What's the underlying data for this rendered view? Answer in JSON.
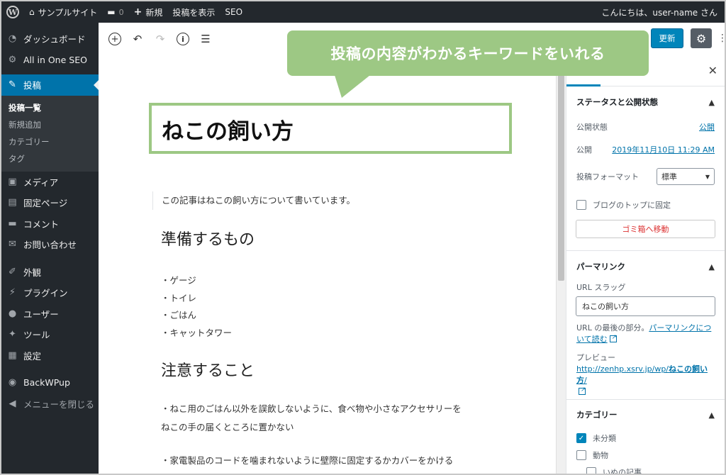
{
  "adminbar": {
    "site_name": "サンプルサイト",
    "comment_count": "0",
    "new_label": "新規",
    "view_post": "投稿を表示",
    "seo": "SEO",
    "greeting": "こんにちは、user-name さん"
  },
  "sidebar": {
    "items": [
      {
        "label": "ダッシュボード",
        "icon": "dashboard-icon"
      },
      {
        "label": "All in One SEO",
        "icon": "gear-icon"
      },
      {
        "label": "投稿",
        "icon": "pin-icon"
      },
      {
        "label": "メディア",
        "icon": "media-icon"
      },
      {
        "label": "固定ページ",
        "icon": "page-icon"
      },
      {
        "label": "コメント",
        "icon": "comment-icon"
      },
      {
        "label": "お問い合わせ",
        "icon": "mail-icon"
      },
      {
        "label": "外観",
        "icon": "brush-icon"
      },
      {
        "label": "プラグイン",
        "icon": "plugin-icon"
      },
      {
        "label": "ユーザー",
        "icon": "user-icon"
      },
      {
        "label": "ツール",
        "icon": "wrench-icon"
      },
      {
        "label": "設定",
        "icon": "settings-icon"
      },
      {
        "label": "BackWPup",
        "icon": "backwpup-icon"
      },
      {
        "label": "メニューを閉じる",
        "icon": "collapse-icon"
      }
    ],
    "submenu": [
      "投稿一覧",
      "新規追加",
      "カテゴリー",
      "タグ"
    ]
  },
  "editor": {
    "post_title": "ねこの飼い方",
    "intro": "この記事はねこの飼い方について書いています。",
    "heading1": "準備するもの",
    "list": [
      "・ゲージ",
      "・トイレ",
      "・ごはん",
      "・キャットタワー"
    ],
    "heading2": "注意すること",
    "para1_line1": "・ねこ用のごはん以外を誤飲しないように、食べ物や小さなアクセサリーを",
    "para1_line2": "ねこの手の届くところに置かない",
    "para2": "・家電製品のコードを噛まれないように壁際に固定するかカバーをかける"
  },
  "callout": {
    "text": "投稿の内容がわかるキーワードをいれる",
    "color": "#9dc884"
  },
  "actions": {
    "update": "更新"
  },
  "settings": {
    "status_panel": {
      "title": "ステータスと公開状態",
      "visibility_label": "公開状態",
      "visibility_value": "公開",
      "publish_label": "公開",
      "publish_value": "2019年11月10日 11:29 AM",
      "format_label": "投稿フォーマット",
      "format_value": "標準",
      "sticky_label": "ブログのトップに固定",
      "trash_label": "ゴミ箱へ移動"
    },
    "permalink_panel": {
      "title": "パーマリンク",
      "slug_label": "URL スラッグ",
      "slug_value": "ねこの飼い方",
      "note_prefix": "URL の最後の部分。",
      "note_link_line1": "パーマリンクにつ",
      "note_link_line2": "いて読む",
      "preview_label": "プレビュー",
      "preview_url_prefix": "http://zenhp.xsrv.jp/wp/",
      "preview_url_slug": "ねこの飼い方",
      "preview_url_suffix": "/"
    },
    "category_panel": {
      "title": "カテゴリー",
      "items": [
        {
          "label": "未分類",
          "checked": true
        },
        {
          "label": "動物",
          "checked": false
        },
        {
          "label": "いぬの記事",
          "checked": false
        }
      ]
    }
  }
}
